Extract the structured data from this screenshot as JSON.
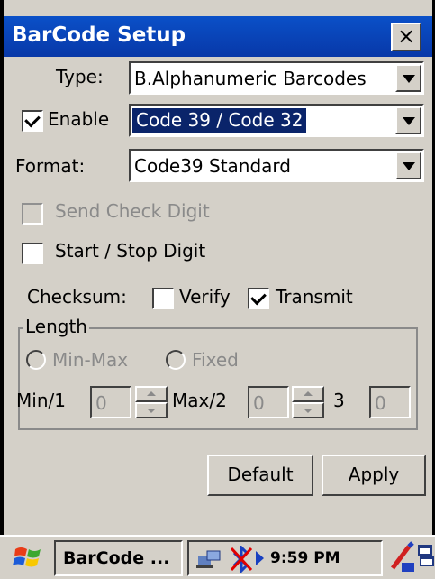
{
  "window": {
    "title": "BarCode Setup",
    "close_label": "×"
  },
  "type_row": {
    "label": "Type:",
    "value": "B.Alphanumeric Barcodes"
  },
  "enable_row": {
    "label": "Enable",
    "checked": true,
    "value": "Code 39 / Code 32"
  },
  "format_row": {
    "label": "Format:",
    "value": "Code39 Standard"
  },
  "send_check_digit": {
    "label": "Send Check Digit",
    "checked": false,
    "enabled": false
  },
  "start_stop_digit": {
    "label": "Start / Stop Digit",
    "checked": false
  },
  "checksum": {
    "label": "Checksum:",
    "verify_label": "Verify",
    "verify_checked": false,
    "transmit_label": "Transmit",
    "transmit_checked": true
  },
  "length": {
    "group_label": "Length",
    "minmax_label": "Min-Max",
    "fixed_label": "Fixed",
    "min_label": "Min/1",
    "min_value": "0",
    "max_label": "Max/2",
    "max_value": "0",
    "third_label": "3",
    "third_value": "0"
  },
  "buttons": {
    "default_label": "Default",
    "apply_label": "Apply"
  },
  "taskbar": {
    "task_label": "BarCode ...",
    "clock": "9:59 PM"
  },
  "icons": [
    "windows-start-icon",
    "network-icon",
    "bluetooth-icon",
    "arrow-right-icon",
    "input-panel-icon",
    "desktop-icon"
  ]
}
